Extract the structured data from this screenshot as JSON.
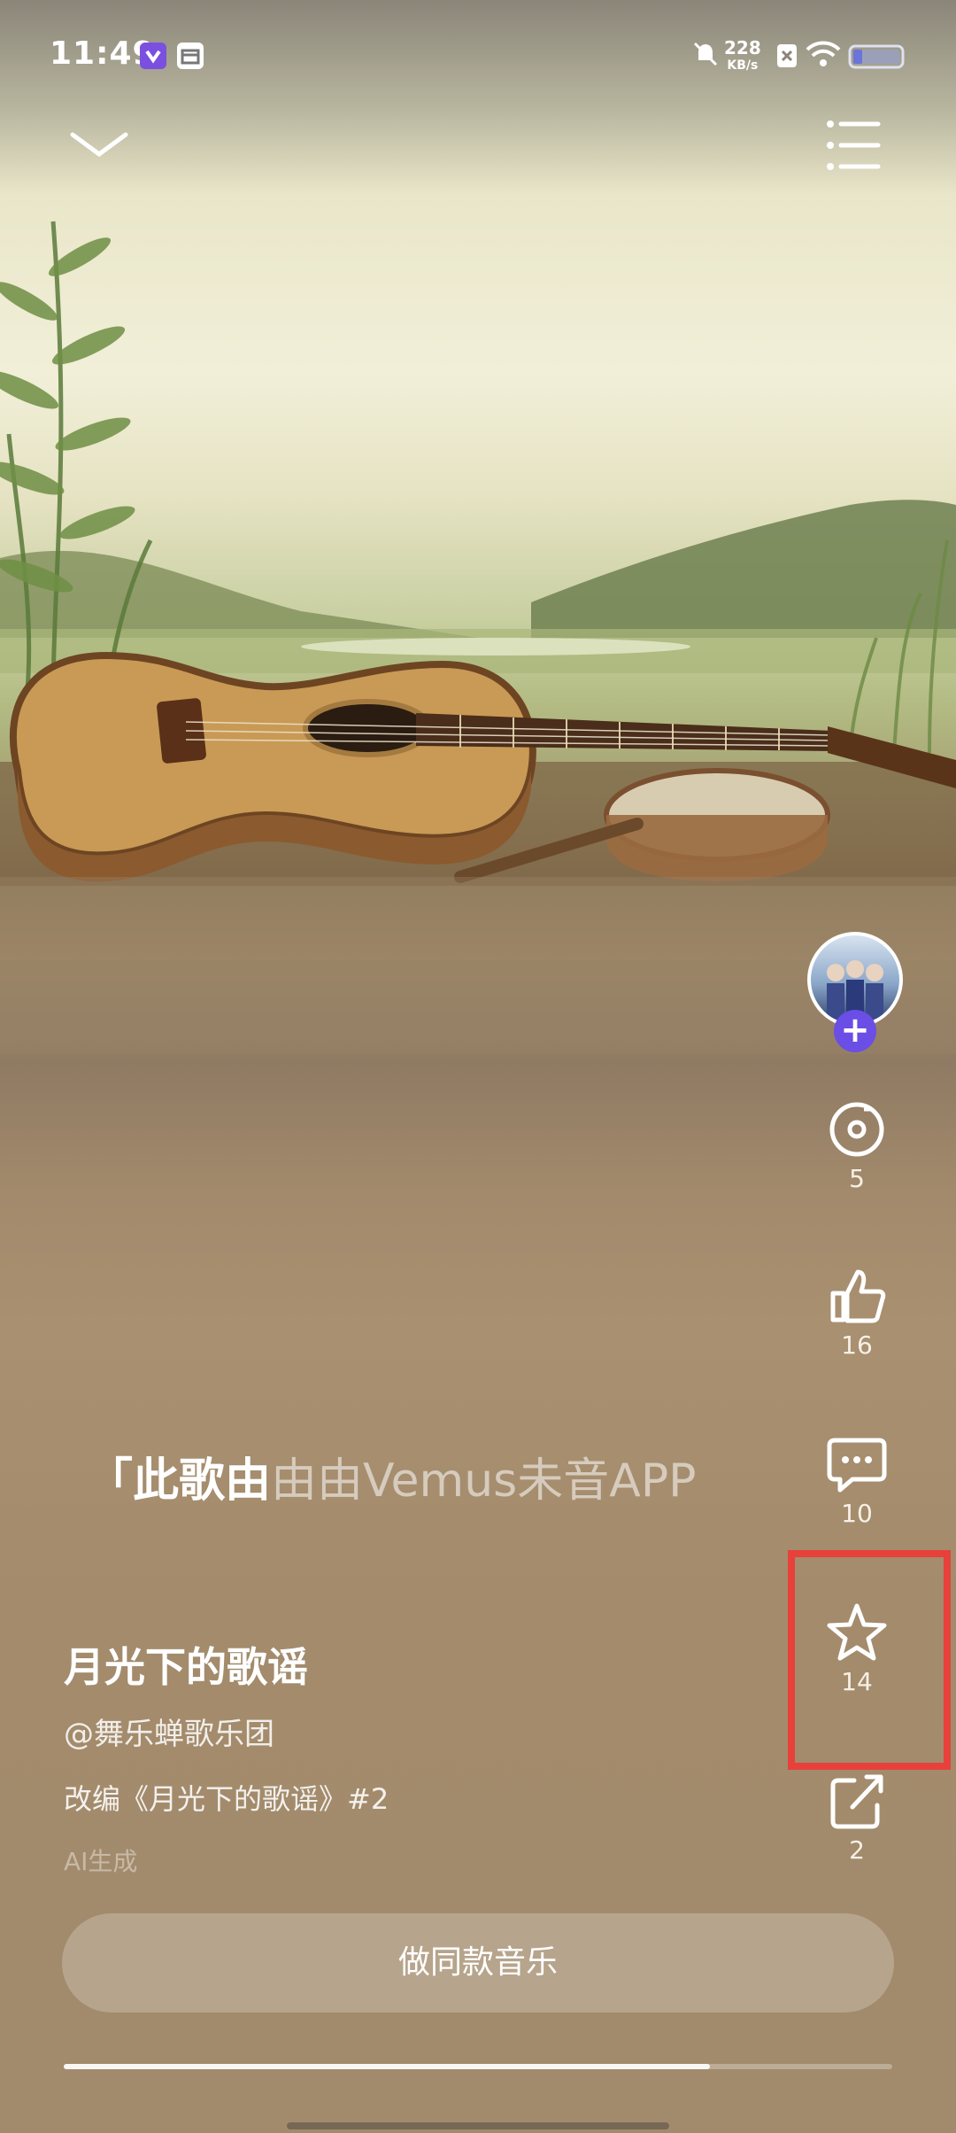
{
  "status_bar": {
    "time": "11:49",
    "net_speed_value": "228",
    "net_speed_unit": "KB/s",
    "accent": "#7b4fe0"
  },
  "top_bar": {
    "collapse_icon": "chevron-down-icon",
    "playlist_icon": "playlist-icon"
  },
  "side_actions": {
    "follow_label": "+",
    "items": [
      {
        "icon": "music-disc-icon",
        "count": "5"
      },
      {
        "icon": "thumbs-up-icon",
        "count": "16"
      },
      {
        "icon": "comment-icon",
        "count": "10"
      },
      {
        "icon": "star-icon",
        "count": "14"
      },
      {
        "icon": "share-icon",
        "count": "2"
      }
    ]
  },
  "lyric": {
    "bright": "「此歌由",
    "dim": "由由Vemus未音APP制"
  },
  "song": {
    "title": "月光下的歌谣",
    "author": "@舞乐蝉歌乐团",
    "description": "改编《月光下的歌谣》#2",
    "ai_tag": "AI生成"
  },
  "actions": {
    "make_same": "做同款音乐"
  },
  "playback": {
    "progress_fraction": 0.78
  },
  "highlight_color": "#e8403b"
}
